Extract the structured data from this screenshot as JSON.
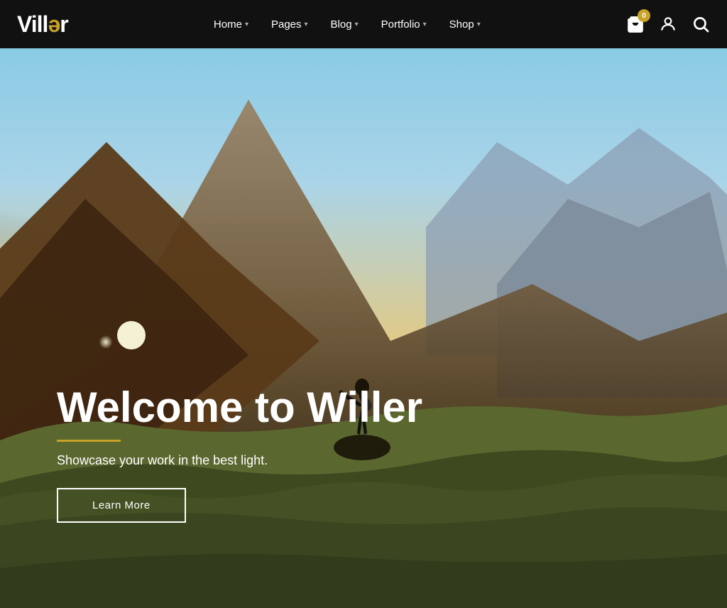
{
  "logo": {
    "text_before": "Vill",
    "text_highlight": "ə",
    "text_after": "r"
  },
  "navbar": {
    "links": [
      {
        "label": "Home",
        "has_dropdown": true
      },
      {
        "label": "Pages",
        "has_dropdown": true
      },
      {
        "label": "Blog",
        "has_dropdown": true
      },
      {
        "label": "Portfolio",
        "has_dropdown": true
      },
      {
        "label": "Shop",
        "has_dropdown": true
      }
    ],
    "cart_count": "0",
    "cart_label": "Shopping cart",
    "account_label": "Account",
    "search_label": "Search"
  },
  "hero": {
    "title": "Welcome to Willer",
    "subtitle": "Showcase your work in the best light.",
    "cta_label": "Learn More",
    "divider_color": "#c9a227"
  }
}
